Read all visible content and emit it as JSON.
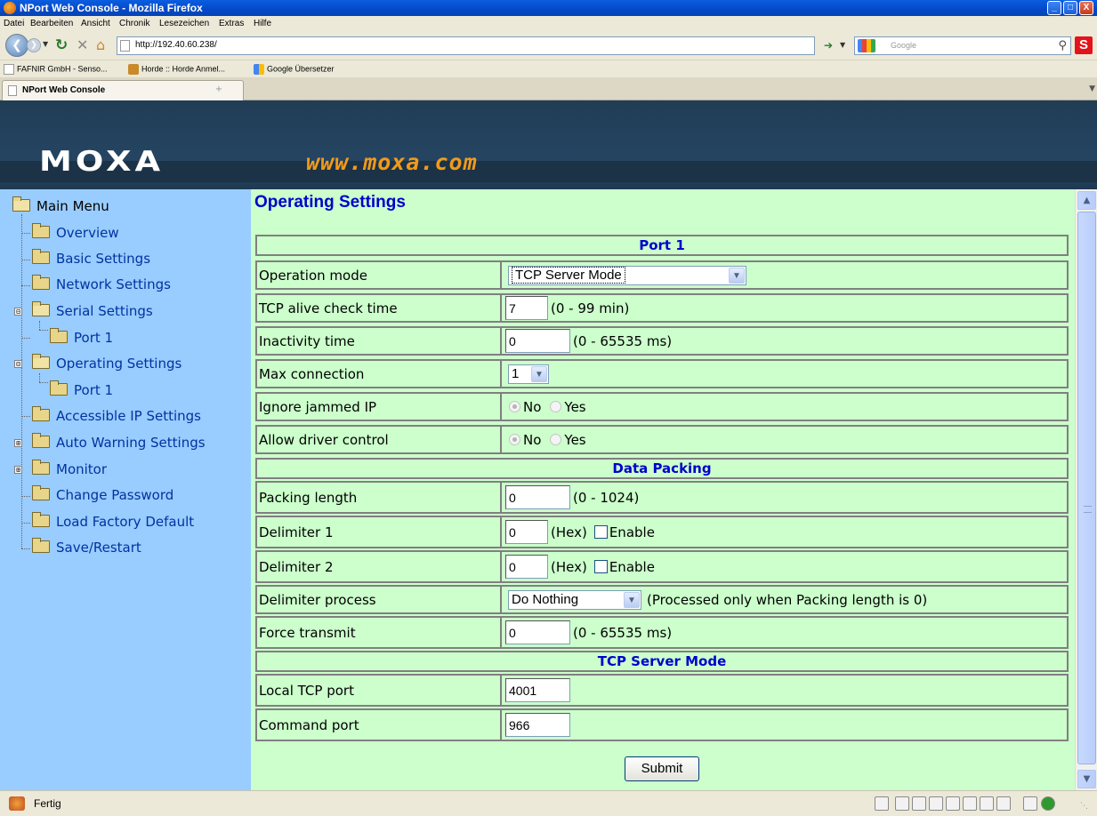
{
  "window": {
    "title": "NPort Web Console - Mozilla Firefox",
    "buttons": {
      "minimize": "_",
      "maximize": "□",
      "close": "X"
    }
  },
  "menubar": [
    "Datei",
    "Bearbeiten",
    "Ansicht",
    "Chronik",
    "Lesezeichen",
    "Extras",
    "Hilfe"
  ],
  "navigation": {
    "url": "http://192.40.60.238/",
    "search_placeholder": "Google",
    "back_icon": "back-arrow-icon",
    "reload_icon": "reload-icon",
    "stop_icon": "stop-icon",
    "home_icon": "home-icon"
  },
  "bookmarks": [
    "FAFNIR GmbH - Senso...",
    "Horde :: Horde Anmel...",
    "Google Übersetzer"
  ],
  "tabs": [
    {
      "label": "NPort Web Console"
    }
  ],
  "header": {
    "logo": "MOXA",
    "site": "www.moxa.com"
  },
  "menu": {
    "root": "Main Menu",
    "items": [
      "Overview",
      "Basic Settings",
      "Network Settings",
      "Serial Settings",
      "Port 1",
      "Operating Settings",
      "Port 1",
      "Accessible IP Settings",
      "Auto Warning Settings",
      "Monitor",
      "Change Password",
      "Load Factory Default",
      "Save/Restart"
    ],
    "expanders": {
      "serial": "⊟",
      "operating": "⊟",
      "auto_warning": "⊞",
      "monitor": "⊞"
    }
  },
  "page": {
    "title": "Operating Settings",
    "sections": {
      "port": "Port 1",
      "packing": "Data Packing",
      "server": "TCP Server Mode"
    },
    "fields": {
      "operation_mode": {
        "label": "Operation mode",
        "value": "TCP Server Mode"
      },
      "tcp_alive": {
        "label": "TCP alive check time",
        "value": "7",
        "unit": "(0 - 99 min)"
      },
      "inactivity": {
        "label": "Inactivity time",
        "value": "0",
        "unit": "(0 - 65535 ms)"
      },
      "max_connection": {
        "label": "Max connection",
        "value": "1"
      },
      "ignore_jammed": {
        "label": "Ignore jammed IP",
        "opt_no": "No",
        "opt_yes": "Yes",
        "selected": "No"
      },
      "allow_driver": {
        "label": "Allow driver control",
        "opt_no": "No",
        "opt_yes": "Yes",
        "selected": "No"
      },
      "packing_length": {
        "label": "Packing length",
        "value": "0",
        "unit": "(0 - 1024)"
      },
      "delimiter1": {
        "label": "Delimiter 1",
        "value": "0",
        "unit": "(Hex)",
        "enable": "Enable",
        "enabled": false
      },
      "delimiter2": {
        "label": "Delimiter 2",
        "value": "0",
        "unit": "(Hex)",
        "enable": "Enable",
        "enabled": false
      },
      "delimiter_process": {
        "label": "Delimiter process",
        "value": "Do Nothing",
        "note": "(Processed only when Packing length is 0)"
      },
      "force_transmit": {
        "label": "Force transmit",
        "value": "0",
        "unit": "(0 - 65535 ms)"
      },
      "local_tcp_port": {
        "label": "Local TCP port",
        "value": "4001"
      },
      "command_port": {
        "label": "Command port",
        "value": "966"
      }
    },
    "submit": "Submit"
  },
  "status": {
    "text": "Fertig"
  },
  "colors": {
    "sidebar": "#99ccff",
    "content": "#ccffcc",
    "header": "#213d55",
    "accent": "#f09a1b",
    "title_blue": "#0000cc"
  }
}
